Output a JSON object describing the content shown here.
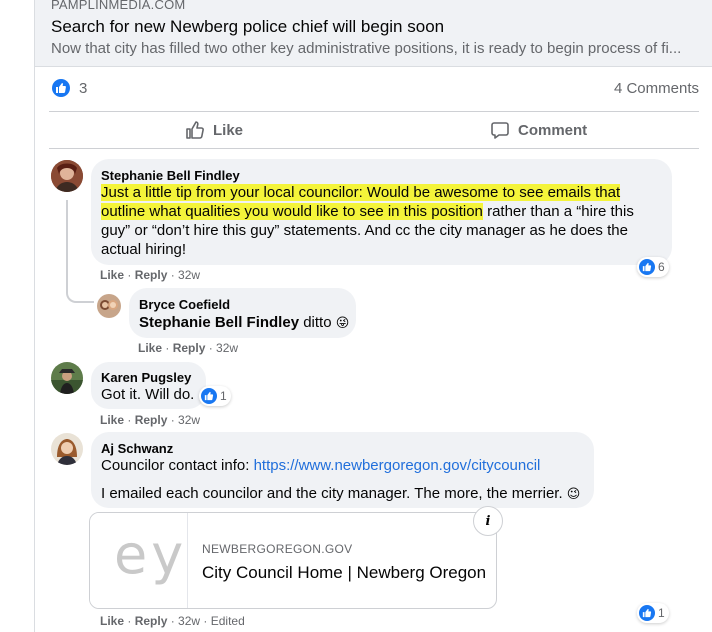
{
  "link_preview": {
    "domain": "PAMPLINMEDIA.COM",
    "title": "Search for new Newberg police chief will begin soon",
    "description": "Now that city has filled two other key administrative positions, it is ready to begin process of fi..."
  },
  "reactions": {
    "count": "3",
    "comments": "4 Comments"
  },
  "actions": {
    "like": "Like",
    "comment": "Comment"
  },
  "comments": [
    {
      "author": "Stephanie Bell Findley",
      "text_hl1": "Just a little tip from your local councilor: Would be awesome to see emails that",
      "text_hl2": "outline what qualities you would like to see in this position",
      "text_rest2": " rather than a “hire this",
      "text_line3": "guy” or “don’t hire this guy” statements. And cc the city manager as he does the",
      "text_line4": "actual hiring!",
      "like": "Like",
      "reply": "Reply",
      "time": "32w",
      "reaction_count": "6",
      "reply_comment": {
        "author": "Bryce Coefield",
        "mention": "Stephanie Bell Findley",
        "text": " ditto",
        "emoji": "😜",
        "like": "Like",
        "reply": "Reply",
        "time": "32w"
      }
    },
    {
      "author": "Karen Pugsley",
      "text": "Got it. Will do.",
      "like": "Like",
      "reply": "Reply",
      "time": "32w",
      "reaction_count": "1"
    },
    {
      "author": "Aj Schwanz",
      "line1_prefix": "Councilor contact info: ",
      "line1_link": "https://www.newbergoregon.gov/citycouncil",
      "line2": "I emailed each councilor and the city manager. The more, the merrier.",
      "emoji": "😉",
      "preview_domain": "NEWBERGOREGON.GOV",
      "preview_title": "City Council Home | Newberg Oregon",
      "preview_image_text": "ey",
      "like": "Like",
      "reply": "Reply",
      "time": "32w",
      "edited": "Edited",
      "reaction_count": "1"
    }
  ],
  "colors": {
    "accent": "#1877f2",
    "highlight": "#f4f43a",
    "link": "#216fdb"
  }
}
